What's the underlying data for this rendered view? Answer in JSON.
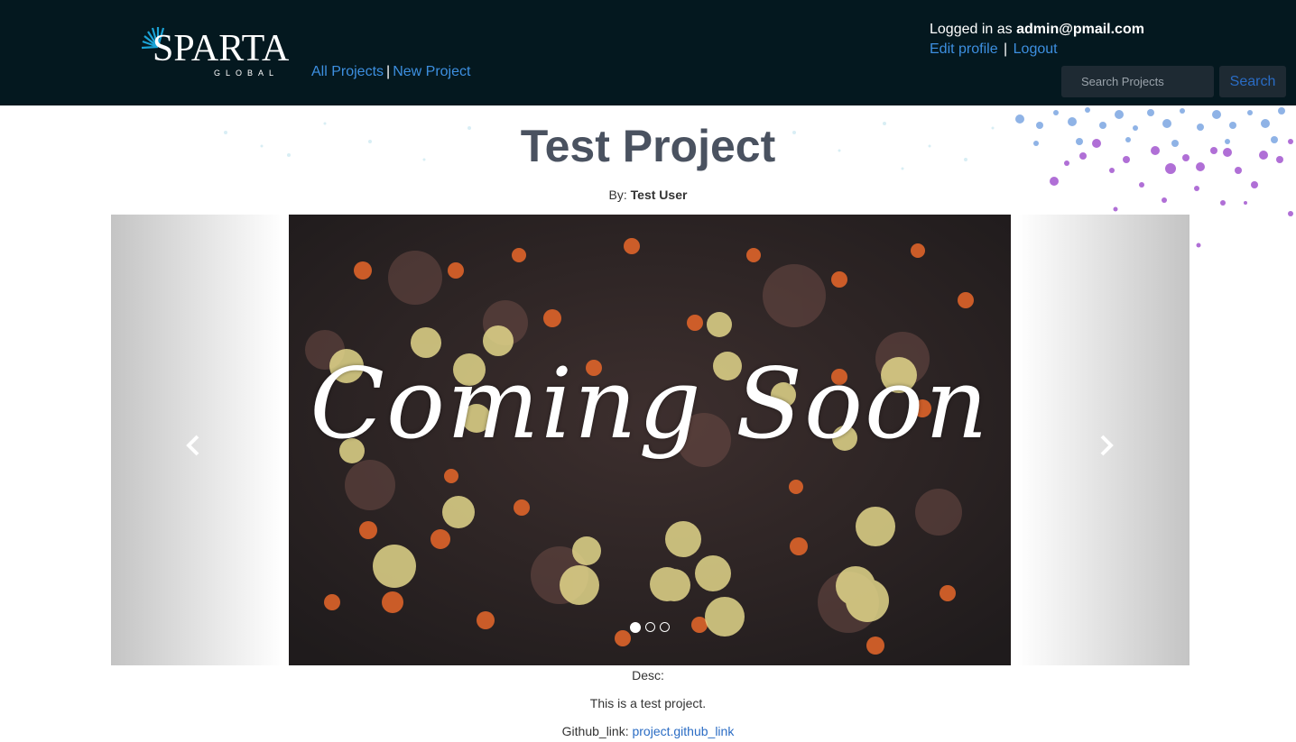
{
  "header": {
    "logo_text": "SPARTA",
    "logo_sub": "GLOBAL",
    "nav": {
      "all_projects": "All Projects",
      "separator": "|",
      "new_project": "New Project"
    },
    "user": {
      "logged_in_prefix": "Logged in as",
      "email": "admin@pmail.com",
      "edit_profile": "Edit profile",
      "separator": "|",
      "logout": "Logout"
    },
    "search": {
      "placeholder": "Search Projects",
      "value": "",
      "button_label": "Search"
    }
  },
  "project": {
    "title": "Test Project",
    "by_label": "By:",
    "author": "Test User",
    "carousel": {
      "slide_text": "Coming Soon",
      "prev_icon": "chevron-left-icon",
      "next_icon": "chevron-right-icon",
      "slide_count": 3,
      "active_index": 0
    },
    "desc_label": "Desc:",
    "description": "This is a test project.",
    "github_label": "Github_link:",
    "github_link": "project.github_link"
  },
  "colors": {
    "header_bg": "#04181f",
    "link": "#3d8fe0",
    "title": "#4a5260",
    "logo_accent": "#1ba3d6"
  }
}
